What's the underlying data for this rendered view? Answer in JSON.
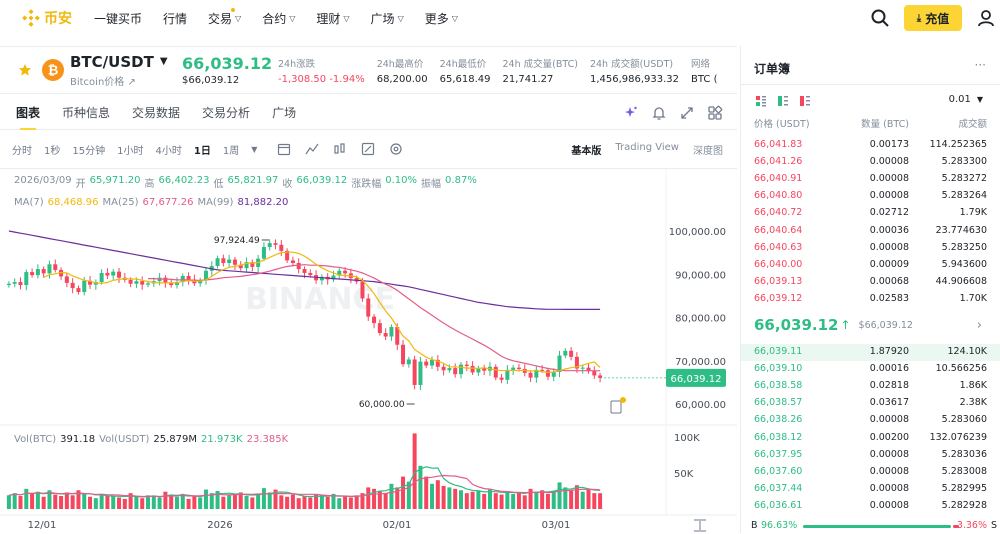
{
  "nav": {
    "logo": "币安",
    "items": [
      {
        "label": "一键买币",
        "caret": false
      },
      {
        "label": "行情",
        "caret": false
      },
      {
        "label": "交易",
        "caret": true,
        "dot": true
      },
      {
        "label": "合约",
        "caret": true
      },
      {
        "label": "理财",
        "caret": true
      },
      {
        "label": "广场",
        "caret": true
      },
      {
        "label": "更多",
        "caret": true
      }
    ],
    "deposit": "充值",
    "icons": [
      "search-icon",
      "user-icon",
      "download-icon"
    ]
  },
  "ticker": {
    "symbol": "BTC/USDT",
    "subtitle": "Bitcoin价格",
    "price": "66,039.12",
    "price_usd": "$66,039.12",
    "stats": [
      {
        "label": "24h涨跌",
        "value": "-1,308.50 -1.94%",
        "negative": true
      },
      {
        "label": "24h最高价",
        "value": "68,200.00"
      },
      {
        "label": "24h最低价",
        "value": "65,618.49"
      },
      {
        "label": "24h 成交量(BTC)",
        "value": "21,741.27"
      },
      {
        "label": "24h 成交额(USDT)",
        "value": "1,456,986,933.32"
      },
      {
        "label": "网络",
        "value": "BTC ("
      }
    ]
  },
  "tabs": [
    "图表",
    "币种信息",
    "交易数据",
    "交易分析",
    "广场"
  ],
  "toolbar": {
    "intervals": [
      "分时",
      "1秒",
      "15分钟",
      "1小时",
      "4小时",
      "1日",
      "1周"
    ],
    "active_interval": "1日",
    "views": [
      "基本版",
      "Trading View",
      "深度图"
    ],
    "active_view": "基本版"
  },
  "chart_header": {
    "date": "2026/03/09",
    "open_label": "开",
    "open": "65,971.20",
    "high_label": "高",
    "high": "66,402.23",
    "low_label": "低",
    "low": "65,821.97",
    "close_label": "收",
    "close": "66,039.12",
    "change_label": "涨跌幅",
    "change": "0.10%",
    "amp_label": "振幅",
    "amp": "0.87%",
    "ma7_label": "MA(7)",
    "ma7": "68,468.96",
    "ma25_label": "MA(25)",
    "ma25": "67,677.26",
    "ma99_label": "MA(99)",
    "ma99": "81,882.20",
    "vol_btc_label": "Vol(BTC)",
    "vol_btc": "391.18",
    "vol_usdt_label": "Vol(USDT)",
    "vol_usdt": "25.879M",
    "vol_ma1": "21.973K",
    "vol_ma2": "23.385K"
  },
  "chart_data": {
    "type": "candlestick",
    "y_ticks": [
      "100,000.00",
      "90,000.00",
      "80,000.00",
      "70,000.00",
      "60,000.00"
    ],
    "y_tick_values": [
      100000,
      90000,
      80000,
      70000,
      60000
    ],
    "x_ticks": [
      "12/01",
      "2026",
      "02/01",
      "03/01"
    ],
    "vol_ticks": [
      "100K",
      "50K"
    ],
    "vol_tick_values": [
      100000,
      50000
    ],
    "current_price": "66,039.12",
    "high_mark": "97,924.49",
    "low_mark": "60,000.00",
    "closes": [
      87800,
      88200,
      87500,
      90500,
      89800,
      91200,
      90200,
      92300,
      91000,
      89500,
      88000,
      86800,
      85900,
      88500,
      87600,
      88200,
      90300,
      89700,
      90600,
      89200,
      88700,
      87800,
      88400,
      87600,
      87900,
      88400,
      89200,
      88100,
      87500,
      88200,
      89600,
      88800,
      87900,
      88600,
      90800,
      91900,
      93700,
      92600,
      93400,
      92200,
      91400,
      92800,
      91700,
      93600,
      96300,
      97200,
      96800,
      95400,
      93200,
      92600,
      91200,
      90300,
      89800,
      88600,
      89400,
      88800,
      89700,
      90800,
      90200,
      89100,
      88300,
      84400,
      80200,
      78700,
      76400,
      75600,
      77800,
      73700,
      69200,
      70300,
      64400,
      69800,
      68900,
      70200,
      68600,
      67800,
      68300,
      66900,
      69100,
      68800,
      67300,
      68200,
      67700,
      68600,
      66100,
      65600,
      67900,
      68400,
      68100,
      67200,
      66100,
      67900,
      67800,
      66300,
      67400,
      71200,
      72300,
      70900,
      68200,
      68400,
      67600,
      66600,
      66039
    ],
    "volumes": [
      19000,
      22000,
      18000,
      28000,
      21000,
      24000,
      17000,
      26000,
      20000,
      18000,
      23000,
      19000,
      26000,
      21000,
      17000,
      15000,
      20000,
      19000,
      18000,
      16000,
      14000,
      22000,
      17000,
      15000,
      19000,
      18000,
      16000,
      24000,
      20000,
      17000,
      21000,
      14000,
      18000,
      16000,
      27000,
      22000,
      25000,
      17000,
      19000,
      21000,
      23000,
      18000,
      16000,
      20000,
      29000,
      23000,
      27000,
      19000,
      17000,
      20000,
      15000,
      18000,
      16000,
      20000,
      19000,
      17000,
      21000,
      15000,
      18000,
      16000,
      19000,
      22000,
      30000,
      28000,
      25000,
      22000,
      35000,
      30000,
      45000,
      38000,
      105000,
      60000,
      45000,
      35000,
      40000,
      32000,
      30000,
      28000,
      26000,
      22000,
      24000,
      26000,
      21000,
      27000,
      22000,
      20000,
      25000,
      21000,
      23000,
      19000,
      28000,
      24000,
      26000,
      21000,
      25000,
      37000,
      30000,
      25000,
      33000,
      24000,
      28000,
      22000,
      21973
    ],
    "ma7": [
      null,
      null,
      null,
      null,
      null,
      null,
      89300,
      89900,
      90100,
      90400,
      90300,
      89600,
      89100,
      88600,
      88400,
      88000,
      87900,
      88100,
      88600,
      88800,
      89000,
      88900,
      88900,
      88600,
      88300,
      88100,
      88000,
      88000,
      88000,
      88000,
      88400,
      88500,
      88400,
      88400,
      88700,
      89500,
      90400,
      91100,
      91600,
      91800,
      92100,
      92500,
      92600,
      92700,
      93300,
      93900,
      94500,
      95000,
      95100,
      95100,
      94800,
      94200,
      93300,
      92300,
      91500,
      90800,
      90300,
      89800,
      89700,
      89600,
      89400,
      88600,
      87200,
      85500,
      83500,
      81500,
      79900,
      77800,
      75700,
      74600,
      72600,
      71700,
      70800,
      70300,
      69900,
      69400,
      68600,
      68600,
      68500,
      68300,
      68300,
      68200,
      68400,
      68100,
      67900,
      67700,
      67700,
      67800,
      67700,
      67800,
      67600,
      67700,
      67500,
      67300,
      67400,
      67700,
      68100,
      68400,
      68600,
      69000,
      69400,
      69700,
      68469
    ],
    "ma25": [
      null,
      null,
      null,
      null,
      null,
      null,
      null,
      null,
      null,
      null,
      null,
      null,
      null,
      null,
      null,
      null,
      null,
      null,
      null,
      null,
      null,
      null,
      null,
      null,
      89000,
      89000,
      88900,
      88900,
      88800,
      88700,
      88700,
      88700,
      88600,
      88600,
      88700,
      88800,
      89000,
      89200,
      89300,
      89400,
      89500,
      89700,
      89900,
      90100,
      90400,
      90700,
      91100,
      91500,
      91800,
      92000,
      92100,
      92200,
      92100,
      92100,
      92000,
      91900,
      91700,
      91600,
      91300,
      91000,
      90700,
      90300,
      89700,
      89100,
      88400,
      87700,
      87100,
      86300,
      85300,
      84300,
      83300,
      82300,
      81400,
      80500,
      79600,
      78700,
      77900,
      77100,
      76400,
      75700,
      75000,
      74300,
      73600,
      72800,
      71900,
      71000,
      70400,
      70000,
      69700,
      69400,
      69100,
      68800,
      68500,
      68200,
      68000,
      67800,
      67700,
      67700,
      67700,
      67700,
      67700,
      67700,
      67677
    ],
    "ma99": [
      100000,
      99750,
      99500,
      99250,
      99000,
      98750,
      98500,
      98250,
      98000,
      97750,
      97500,
      97250,
      97000,
      96750,
      96500,
      96250,
      96000,
      95750,
      95500,
      95250,
      95000,
      94750,
      94500,
      94250,
      94000,
      93750,
      93500,
      93250,
      93000,
      92750,
      92500,
      92250,
      92000,
      91750,
      91500,
      91250,
      91000,
      90900,
      90800,
      90700,
      90600,
      90500,
      90400,
      90300,
      90200,
      90100,
      90000,
      89900,
      89800,
      89700,
      89600,
      89500,
      89400,
      89300,
      89200,
      89100,
      89000,
      88900,
      88800,
      88700,
      88600,
      88500,
      88400,
      88300,
      88100,
      87900,
      87700,
      87500,
      87300,
      87100,
      86800,
      86500,
      86200,
      85900,
      85600,
      85300,
      85000,
      84700,
      84400,
      84100,
      83800,
      83500,
      83300,
      83100,
      82900,
      82700,
      82500,
      82400,
      82300,
      82200,
      82100,
      82000,
      81950,
      81900,
      81890,
      81885,
      81882,
      81882,
      81882,
      81882,
      81882,
      81882,
      81882
    ]
  },
  "orderbook": {
    "title": "订单簿",
    "tick_size": "0.01",
    "columns": [
      "价格 (USDT)",
      "数量 (BTC)",
      "成交额"
    ],
    "asks": [
      [
        "66,041.83",
        "0.00173",
        "114.252365"
      ],
      [
        "66,041.26",
        "0.00008",
        "5.283300"
      ],
      [
        "66,040.91",
        "0.00008",
        "5.283272"
      ],
      [
        "66,040.80",
        "0.00008",
        "5.283264"
      ],
      [
        "66,040.72",
        "0.02712",
        "1.79K"
      ],
      [
        "66,040.64",
        "0.00036",
        "23.774630"
      ],
      [
        "66,040.63",
        "0.00008",
        "5.283250"
      ],
      [
        "66,040.00",
        "0.00009",
        "5.943600"
      ],
      [
        "66,039.13",
        "0.00068",
        "44.906608"
      ],
      [
        "66,039.12",
        "0.02583",
        "1.70K"
      ]
    ],
    "mid_price": "66,039.12",
    "mid_usd": "$66,039.12",
    "bids": [
      [
        "66,039.11",
        "1.87920",
        "124.10K"
      ],
      [
        "66,039.10",
        "0.00016",
        "10.566256"
      ],
      [
        "66,038.58",
        "0.02818",
        "1.86K"
      ],
      [
        "66,038.57",
        "0.03617",
        "2.38K"
      ],
      [
        "66,038.26",
        "0.00008",
        "5.283060"
      ],
      [
        "66,038.12",
        "0.00200",
        "132.076239"
      ],
      [
        "66,037.95",
        "0.00008",
        "5.283036"
      ],
      [
        "66,037.60",
        "0.00008",
        "5.283008"
      ],
      [
        "66,037.44",
        "0.00008",
        "5.282995"
      ],
      [
        "66,036.61",
        "0.00008",
        "5.282928"
      ]
    ],
    "buy_label": "B",
    "buy_pct": "96.63%",
    "sell_pct": "3.36%",
    "sell_label": "S"
  }
}
